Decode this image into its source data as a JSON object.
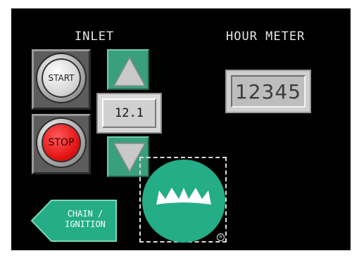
{
  "inlet": {
    "title": "INLET",
    "start_label": "START",
    "stop_label": "STOP",
    "setpoint_value": "12.1"
  },
  "hour_meter": {
    "title": "HOUR METER",
    "value": "12345"
  },
  "nav": {
    "line1": "CHAIN /",
    "line2": "IGNITION"
  },
  "logo": {
    "registered_mark": "R"
  },
  "colors": {
    "background": "#000000",
    "accent_green": "#24ad87",
    "button_green": "#3a9f7c",
    "stop_red": "#e41414"
  },
  "icons": [
    "up-arrow-icon",
    "down-arrow-icon",
    "crown-icon",
    "back-arrow-icon"
  ]
}
